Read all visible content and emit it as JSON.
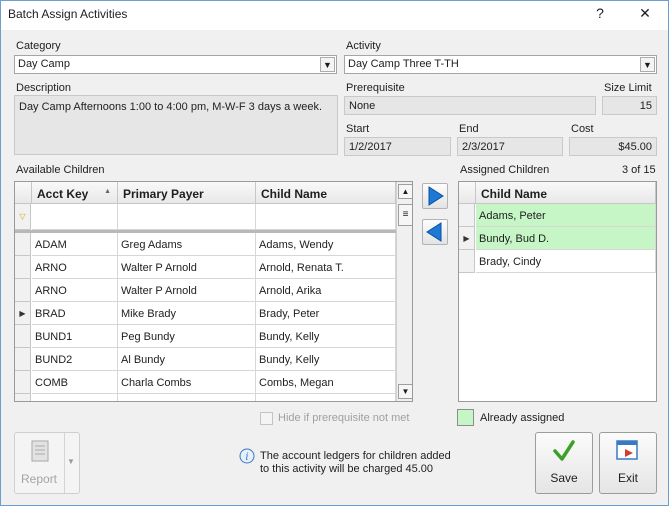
{
  "window": {
    "title": "Batch Assign Activities",
    "help_label": "?",
    "close_label": "✕"
  },
  "category": {
    "label": "Category",
    "value": "Day Camp"
  },
  "activity": {
    "label": "Activity",
    "value": "Day Camp Three T-TH"
  },
  "description": {
    "label": "Description",
    "value": "Day Camp Afternoons 1:00 to 4:00 pm, M-W-F 3 days a week."
  },
  "prerequisite": {
    "label": "Prerequisite",
    "value": "None"
  },
  "size_limit": {
    "label": "Size Limit",
    "value": "15"
  },
  "start": {
    "label": "Start",
    "value": "1/2/2017"
  },
  "end": {
    "label": "End",
    "value": "2/3/2017"
  },
  "cost": {
    "label": "Cost",
    "value": "$45.00"
  },
  "available": {
    "label": "Available Children",
    "columns": [
      "Acct Key",
      "Primary Payer",
      "Child Name"
    ],
    "rows": [
      {
        "acct": "ADAM",
        "payer": "Greg Adams",
        "child": "Adams, Wendy"
      },
      {
        "acct": "ARNO",
        "payer": "Walter P Arnold",
        "child": "Arnold, Renata T."
      },
      {
        "acct": "ARNO",
        "payer": "Walter P Arnold",
        "child": "Arnold, Arika"
      },
      {
        "acct": "BRAD",
        "payer": "Mike Brady",
        "child": "Brady, Peter"
      },
      {
        "acct": "BUND1",
        "payer": "Peg Bundy",
        "child": "Bundy, Kelly"
      },
      {
        "acct": "BUND2",
        "payer": "Al Bundy",
        "child": "Bundy, Kelly"
      },
      {
        "acct": "COMB",
        "payer": "Charla Combs",
        "child": "Combs, Megan"
      }
    ]
  },
  "assigned": {
    "label": "Assigned Children",
    "count": "3 of 15",
    "column": "Child Name",
    "rows": [
      "Adams, Peter",
      "Bundy, Bud D.",
      "Brady, Cindy"
    ]
  },
  "hide_prereq": {
    "label": "Hide if prerequisite not met",
    "checked": false
  },
  "legend": {
    "label": "Already assigned",
    "color": "#c6f5c6"
  },
  "info": {
    "line1": "The account ledgers for children added",
    "line2": "to this activity will be charged 45.00"
  },
  "buttons": {
    "report": "Report",
    "save": "Save",
    "exit": "Exit"
  },
  "colors": {
    "accent": "#1e78d6",
    "assigned_green": "#c6f5c6"
  }
}
